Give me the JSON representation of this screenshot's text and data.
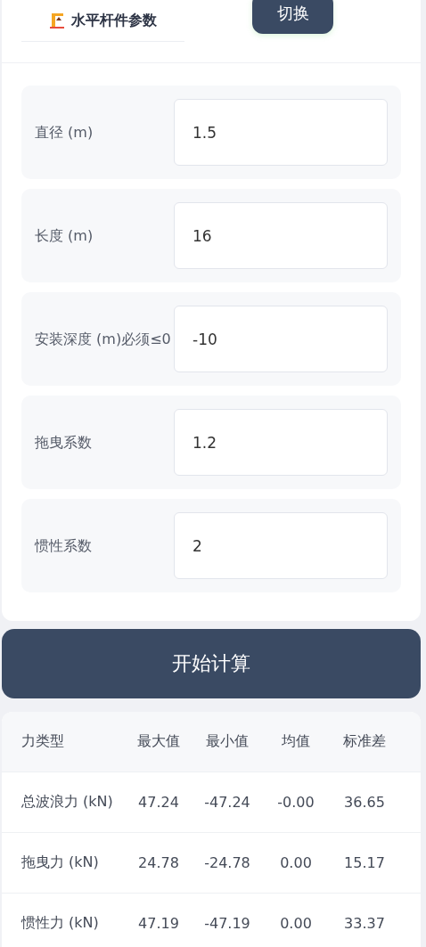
{
  "header": {
    "title": "水平杆件参数",
    "switch_button": "切换"
  },
  "fields": [
    {
      "label": "直径 (m)",
      "value": "1.5"
    },
    {
      "label": "长度 (m)",
      "value": "16"
    },
    {
      "label": "安装深度 (m)必须≤0",
      "value": "-10"
    },
    {
      "label": "拖曳系数",
      "value": "1.2"
    },
    {
      "label": "惯性系数",
      "value": "2"
    }
  ],
  "calculate_button": "开始计算",
  "table": {
    "columns": [
      "力类型",
      "最大值",
      "最小值",
      "均值",
      "标准差"
    ],
    "rows": [
      [
        "总波浪力 (kN)",
        "47.24",
        "-47.24",
        "-0.00",
        "36.65"
      ],
      [
        "拖曳力 (kN)",
        "24.78",
        "-24.78",
        "0.00",
        "15.17"
      ],
      [
        "惯性力 (kN)",
        "47.19",
        "-47.19",
        "0.00",
        "33.37"
      ]
    ]
  }
}
